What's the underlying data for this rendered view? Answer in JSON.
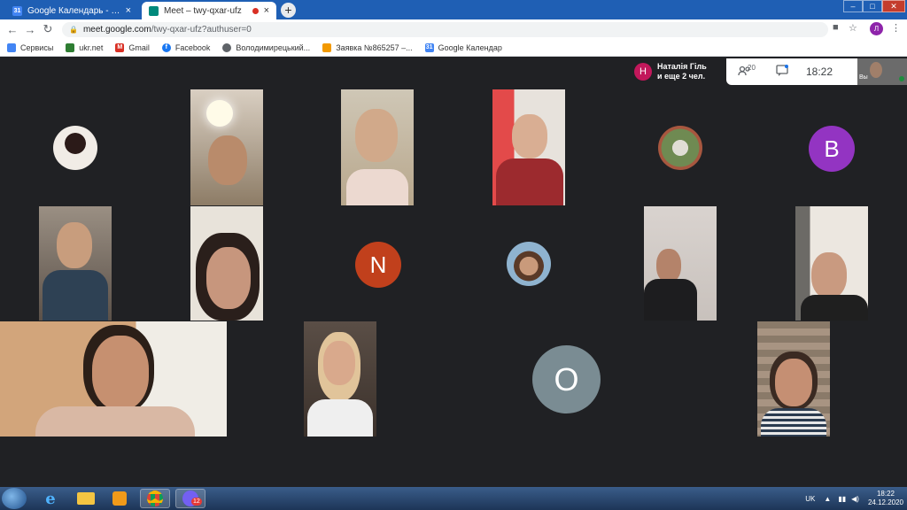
{
  "browser": {
    "tabs": [
      {
        "title": "Google Календарь - Неделя: 20...",
        "close": "×"
      },
      {
        "title": "Meet – twy-qxar-ufz",
        "close": "×"
      }
    ],
    "new_tab": "+",
    "window_controls": {
      "minimize": "–",
      "maximize": "□",
      "close": "✕"
    },
    "url": {
      "host": "meet.google.com",
      "path": "/twy-qxar-ufz?authuser=0"
    },
    "profile_initial": "Л",
    "bookmarks": [
      {
        "label": "Сервисы",
        "icon": "apps-grid-icon",
        "color": "#4285f4"
      },
      {
        "label": "ukr.net",
        "icon": "ukrnet-icon",
        "color": "#2e7d32"
      },
      {
        "label": "Gmail",
        "icon": "gmail-icon",
        "color": "#d93025"
      },
      {
        "label": "Facebook",
        "icon": "facebook-icon",
        "color": "#1877f2"
      },
      {
        "label": "Володимирецький...",
        "icon": "globe-icon",
        "color": "#5f6368"
      },
      {
        "label": "Заявка №865257 –...",
        "icon": "person-icon",
        "color": "#f29900"
      },
      {
        "label": "Google Календар",
        "icon": "google-calendar-icon",
        "color": "#4285f4"
      }
    ]
  },
  "meet": {
    "presenter": {
      "initial": "Н",
      "name": "Наталія Гіль",
      "more": "и еще 2 чел."
    },
    "participants_count": "20",
    "clock": "18:22",
    "self_label": "Вы",
    "letter_avatars": [
      {
        "letter": "B",
        "color": "#9334c2"
      },
      {
        "letter": "N",
        "color": "#c1401c"
      },
      {
        "letter": "O",
        "color": "#7a8c93"
      }
    ]
  },
  "taskbar": {
    "language": "UK",
    "time": "18:22",
    "date": "24.12.2020",
    "viber_badge": "12"
  }
}
